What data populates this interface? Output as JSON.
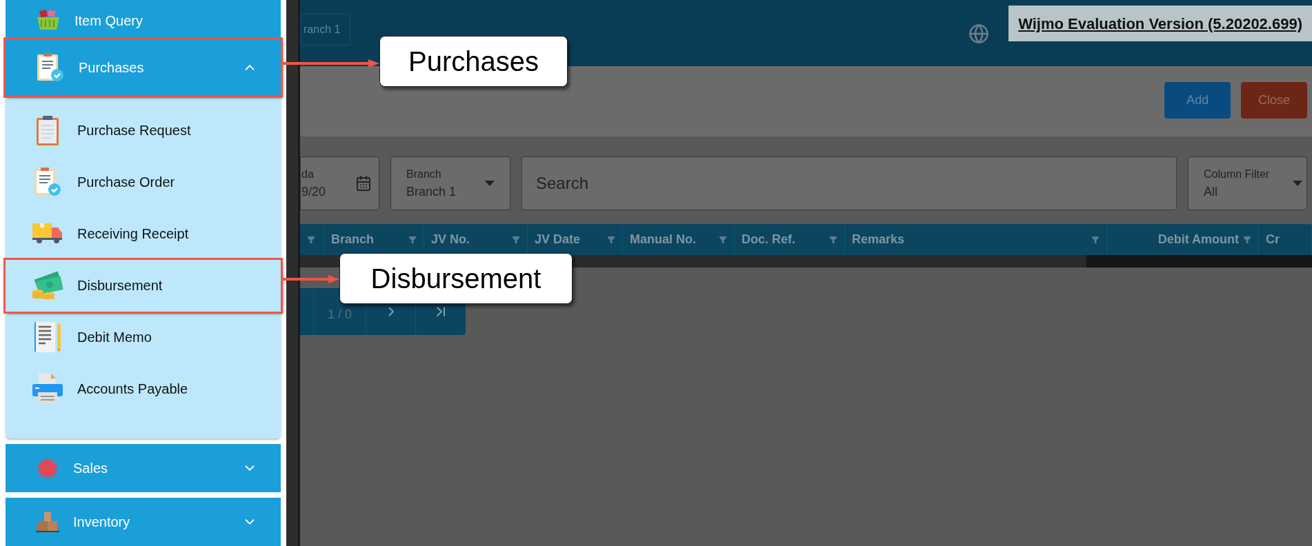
{
  "sidebar": {
    "items": [
      {
        "label": "Item Query",
        "kind": "link",
        "highlighted": false
      },
      {
        "label": "Purchases",
        "kind": "group",
        "expanded": true,
        "highlighted": true,
        "children": [
          {
            "label": "Purchase Request",
            "highlighted": false
          },
          {
            "label": "Purchase Order",
            "highlighted": false
          },
          {
            "label": "Receiving Receipt",
            "highlighted": false
          },
          {
            "label": "Disbursement",
            "highlighted": true
          },
          {
            "label": "Debit Memo",
            "highlighted": false
          },
          {
            "label": "Accounts Payable",
            "highlighted": false
          }
        ]
      },
      {
        "label": "Sales",
        "kind": "group",
        "expanded": false,
        "highlighted": false
      },
      {
        "label": "Inventory",
        "kind": "group",
        "expanded": false,
        "highlighted": false
      }
    ]
  },
  "top_bar": {
    "branch_chip": "ranch 1",
    "banner": "Wijmo Evaluation Version (5.20202.699)"
  },
  "toolbar": {
    "buttons": [
      {
        "label": "Add",
        "kind": "primary"
      },
      {
        "label": "Close",
        "kind": "danger"
      }
    ]
  },
  "filters": {
    "date": {
      "label": "da",
      "value": "9/20"
    },
    "branch": {
      "label": "Branch",
      "value": "Branch 1"
    },
    "search": {
      "placeholder": "Search"
    },
    "column_filter": {
      "label": "Column Filter",
      "value": "All"
    }
  },
  "table": {
    "columns": [
      "",
      "Branch",
      "JV No.",
      "JV Date",
      "Manual No.",
      "Doc. Ref.",
      "Remarks",
      "Debit Amount",
      "Cr"
    ]
  },
  "pager": {
    "page": "1 / 0"
  },
  "callouts": [
    {
      "text": "Purchases"
    },
    {
      "text": "Disbursement"
    }
  ]
}
